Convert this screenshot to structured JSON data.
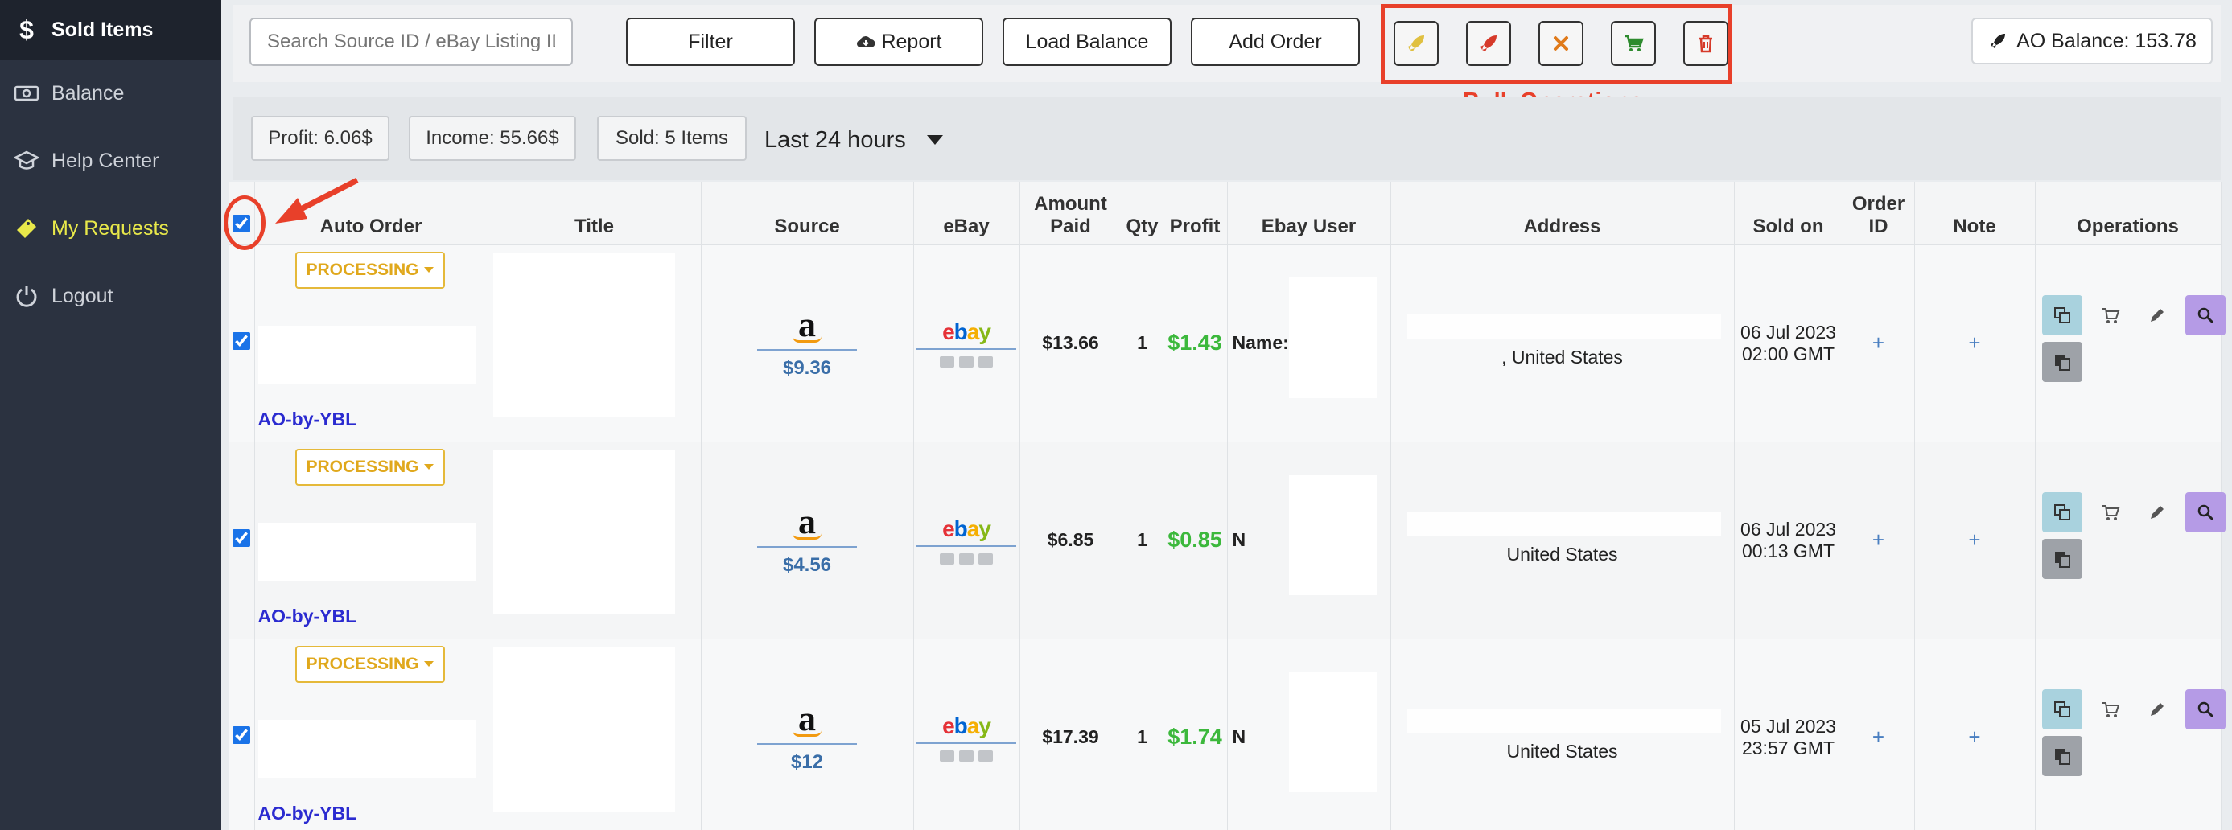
{
  "sidebar": {
    "items": [
      {
        "label": "Sold Items",
        "icon": "dollar-icon"
      },
      {
        "label": "Balance",
        "icon": "money-icon"
      },
      {
        "label": "Help Center",
        "icon": "graduation-cap-icon"
      },
      {
        "label": "My Requests",
        "icon": "ticket-icon"
      },
      {
        "label": "Logout",
        "icon": "power-icon"
      }
    ]
  },
  "toolbar": {
    "search_placeholder": "Search Source ID / eBay Listing ID / Buyer",
    "filter_label": "Filter",
    "report_label": "Report",
    "load_balance_label": "Load Balance",
    "add_order_label": "Add Order",
    "bulk_label": "Bulk Operations",
    "balance_label": "AO Balance: 153.78"
  },
  "stats": {
    "profit": "Profit: 6.06$",
    "income": "Income: 55.66$",
    "sold": "Sold: 5 Items",
    "range": "Last 24 hours"
  },
  "table": {
    "headers": {
      "auto_order": "Auto Order",
      "title": "Title",
      "source": "Source",
      "ebay": "eBay",
      "amount_paid_1": "Amount",
      "amount_paid_2": "Paid",
      "qty": "Qty",
      "profit": "Profit",
      "ebay_user": "Ebay User",
      "address": "Address",
      "sold_on": "Sold on",
      "order_id_1": "Order",
      "order_id_2": "ID",
      "note": "Note",
      "operations": "Operations"
    },
    "rows": [
      {
        "status": "PROCESSING",
        "ao_label": "AO-by-YBL",
        "source_price": "$9.36",
        "amount": "$13.66",
        "qty": "1",
        "profit": "$1.43",
        "user_name_label": "Name:",
        "address_tail": ", United States",
        "sold_date": "06 Jul 2023",
        "sold_time": "02:00 GMT",
        "order_id": "+",
        "note": "+"
      },
      {
        "status": "PROCESSING",
        "ao_label": "AO-by-YBL",
        "source_price": "$4.56",
        "amount": "$6.85",
        "qty": "1",
        "profit": "$0.85",
        "user_name_label": "N",
        "address_tail": "United States",
        "sold_date": "06 Jul 2023",
        "sold_time": "00:13 GMT",
        "order_id": "+",
        "note": "+"
      },
      {
        "status": "PROCESSING",
        "ao_label": "AO-by-YBL",
        "source_price": "$12",
        "amount": "$17.39",
        "qty": "1",
        "profit": "$1.74",
        "user_name_label": "N",
        "address_tail": "United States",
        "sold_date": "05 Jul 2023",
        "sold_time": "23:57 GMT",
        "order_id": "+",
        "note": "+"
      }
    ]
  },
  "colors": {
    "sidebar_bg": "#2b3240",
    "highlight": "#e8402a",
    "profit_green": "#3cb83c",
    "processing_yellow": "#e0a81c",
    "ao_blue": "#2b2bd0"
  }
}
